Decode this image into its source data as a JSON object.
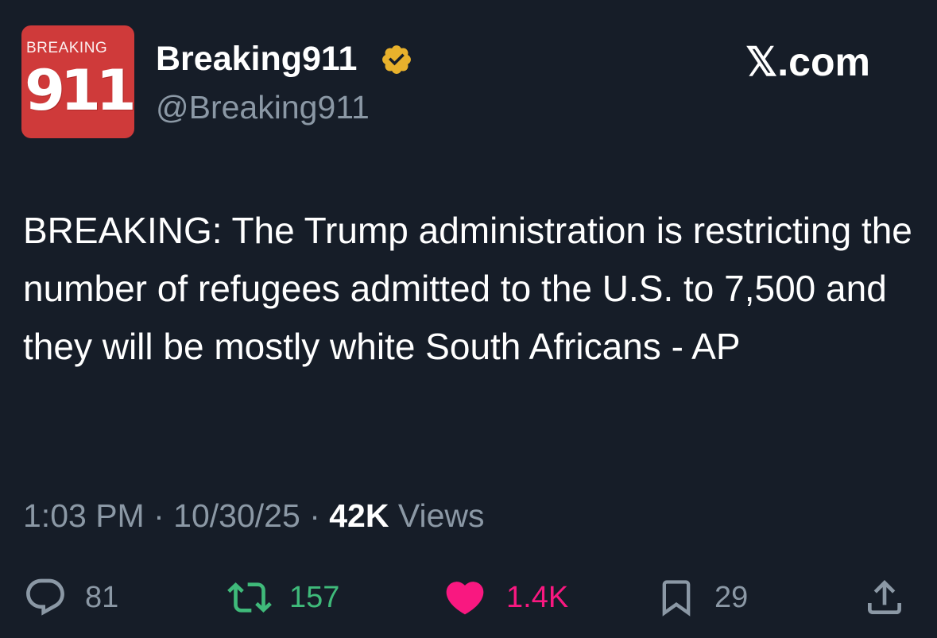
{
  "post": {
    "author": {
      "display_name": "Breaking911",
      "handle": "@Breaking911",
      "verified": true,
      "avatar": {
        "top_text": "BREAKING",
        "number": "911",
        "color": "#cf3a3a"
      }
    },
    "brand": "𝕏.com",
    "text": "BREAKING: The Trump administration is restricting the number of refugees admitted to the U.S. to 7,500 and they will be mostly white South Africans - AP",
    "time": "1:03 PM",
    "separator": "·",
    "date": "10/30/25",
    "views_count": "42K",
    "views_label": "Views",
    "actions": {
      "replies": "81",
      "reposts": "157",
      "likes": "1.4K",
      "bookmarks": "29"
    },
    "icons": [
      "verified-badge-icon",
      "reply-icon",
      "repost-icon",
      "heart-icon",
      "bookmark-icon",
      "share-icon"
    ],
    "colors": {
      "background": "#161d28",
      "secondary_text": "#8b98a5",
      "repost": "#3fba7a",
      "like": "#f91880",
      "verified": "#e8b12c"
    }
  }
}
